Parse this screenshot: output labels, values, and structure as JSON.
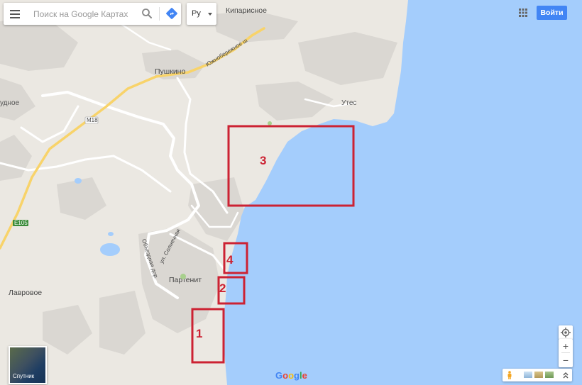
{
  "search": {
    "placeholder": "Поиск на Google Картах"
  },
  "language": {
    "value": "Ру"
  },
  "signin_label": "Войти",
  "satellite_label": "Спутник",
  "google_logo": [
    "G",
    "o",
    "o",
    "g",
    "l",
    "e"
  ],
  "colors": {
    "water": "#a4cdfc",
    "land": "#ebe8e2",
    "urban": "#dad7d2",
    "road": "#ffffff",
    "highway": "#f8d36a",
    "marker": "#cc2233",
    "accent": "#4285f4"
  },
  "places": {
    "kiparisnoe": "Кипарисное",
    "pushkino": "Пушкино",
    "utes": "Утес",
    "partenit": "Партенит",
    "lavrovoe": "Лавровое",
    "udnoe": "удное"
  },
  "roads": {
    "m18": "M18",
    "e105": "E105",
    "yuzhnoberezhnoe": "Южнобережное ш",
    "solnechnaya": "ул. Солнечная",
    "obyezdnaya": "Объездная дор."
  },
  "markers": [
    "1",
    "2",
    "3",
    "4"
  ],
  "icons": {
    "menu": "menu-icon",
    "search": "search-icon",
    "directions": "directions-icon",
    "apps": "apps-grid-icon",
    "locate": "my-location-icon",
    "pegman": "pegman-icon",
    "expand": "expand-icon"
  }
}
